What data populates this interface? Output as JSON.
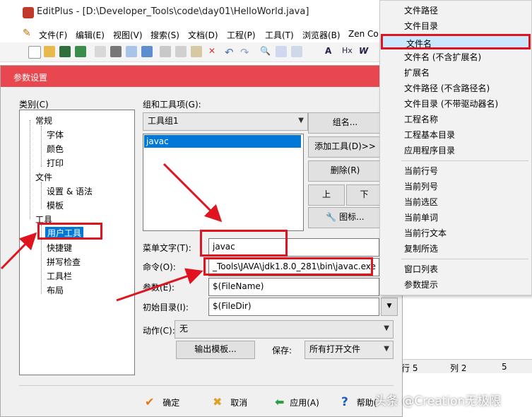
{
  "window": {
    "title": "EditPlus - [D:\\Developer_Tools\\code\\day01\\HelloWorld.java]",
    "menu": [
      "文件(F)",
      "编辑(E)",
      "视图(V)",
      "搜索(S)",
      "文档(D)",
      "工程(P)",
      "工具(T)",
      "浏览器(B)",
      "Zen Co"
    ]
  },
  "status": {
    "col_a": "行 5",
    "col_b": "列 2",
    "col_c": "5"
  },
  "dialog": {
    "title": "参数设置",
    "category_label": "类别(C)",
    "tree": {
      "general": "常规",
      "font": "字体",
      "color": "颜色",
      "print": "打印",
      "files": "文件",
      "settings_syntax": "设置 & 语法",
      "template": "模板",
      "tools": "工具",
      "user_tools": "用户工具",
      "hotkeys": "快捷键",
      "spell_check": "拼写检查",
      "toolbar": "工具栏",
      "layout": "布局"
    },
    "group_label": "组和工具项(G):",
    "group_select": "工具组1",
    "tool_list": [
      "javac"
    ],
    "buttons": {
      "group_name": "组名...",
      "add_tool": "添加工具(D)>>",
      "delete": "删除(R)",
      "up": "上",
      "down": "下",
      "icon": "图标..."
    },
    "menu_text_label": "菜单文字(T):",
    "menu_text_value": "javac",
    "command_label": "命令(O):",
    "command_value": "_Tools\\JAVA\\jdk1.8.0_281\\bin\\javac.exe",
    "args_label": "参数(E):",
    "args_value": "$(FileName)",
    "initdir_label": "初始目录(I):",
    "initdir_value": "$(FileDir)",
    "action_label": "动作(C):",
    "action_value": "无",
    "output_pattern": "输出模板...",
    "save_label": "保存:",
    "save_value": "所有打开文件",
    "footer": {
      "ok": "确定",
      "cancel": "取消",
      "apply": "应用(A)",
      "help": "帮助("
    }
  },
  "context_menu": {
    "items": [
      "文件路径",
      "文件目录",
      "文件名",
      "文件名 (不含扩展名)",
      "扩展名",
      "文件路径 (不含路径名)",
      "文件目录 (不带驱动器名)",
      "工程名称",
      "工程基本目录",
      "应用程序目录",
      "当前行号",
      "当前列号",
      "当前选区",
      "当前单词",
      "当前行文本",
      "复制所选",
      "窗口列表",
      "参数提示"
    ],
    "selected": "文件名"
  },
  "watermark": "头条 @Creation无极限",
  "colors": {
    "dialog_title_bg": "#e8474f",
    "highlight": "#0078d7",
    "annotation_red": "#e0141e",
    "menu_selected": "#cce8ff"
  }
}
